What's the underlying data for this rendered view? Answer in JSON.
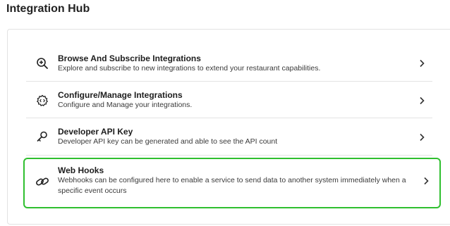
{
  "page": {
    "title": "Integration Hub"
  },
  "items": [
    {
      "title": "Browse And Subscribe Integrations",
      "description": "Explore and subscribe to new integrations to extend your restaurant capabilities.",
      "icon": "zoom-in-icon"
    },
    {
      "title": "Configure/Manage Integrations",
      "description": "Configure and Manage your integrations.",
      "icon": "gear-code-icon"
    },
    {
      "title": "Developer API Key",
      "description": "Developer API key can be generated and able to see the API count",
      "icon": "key-icon"
    },
    {
      "title": "Web Hooks",
      "description": "Webhooks can be configured here to enable a service to send data to another system immediately when a specific event occurs",
      "icon": "link-icon",
      "highlight_color": "#2fbf2f"
    }
  ]
}
